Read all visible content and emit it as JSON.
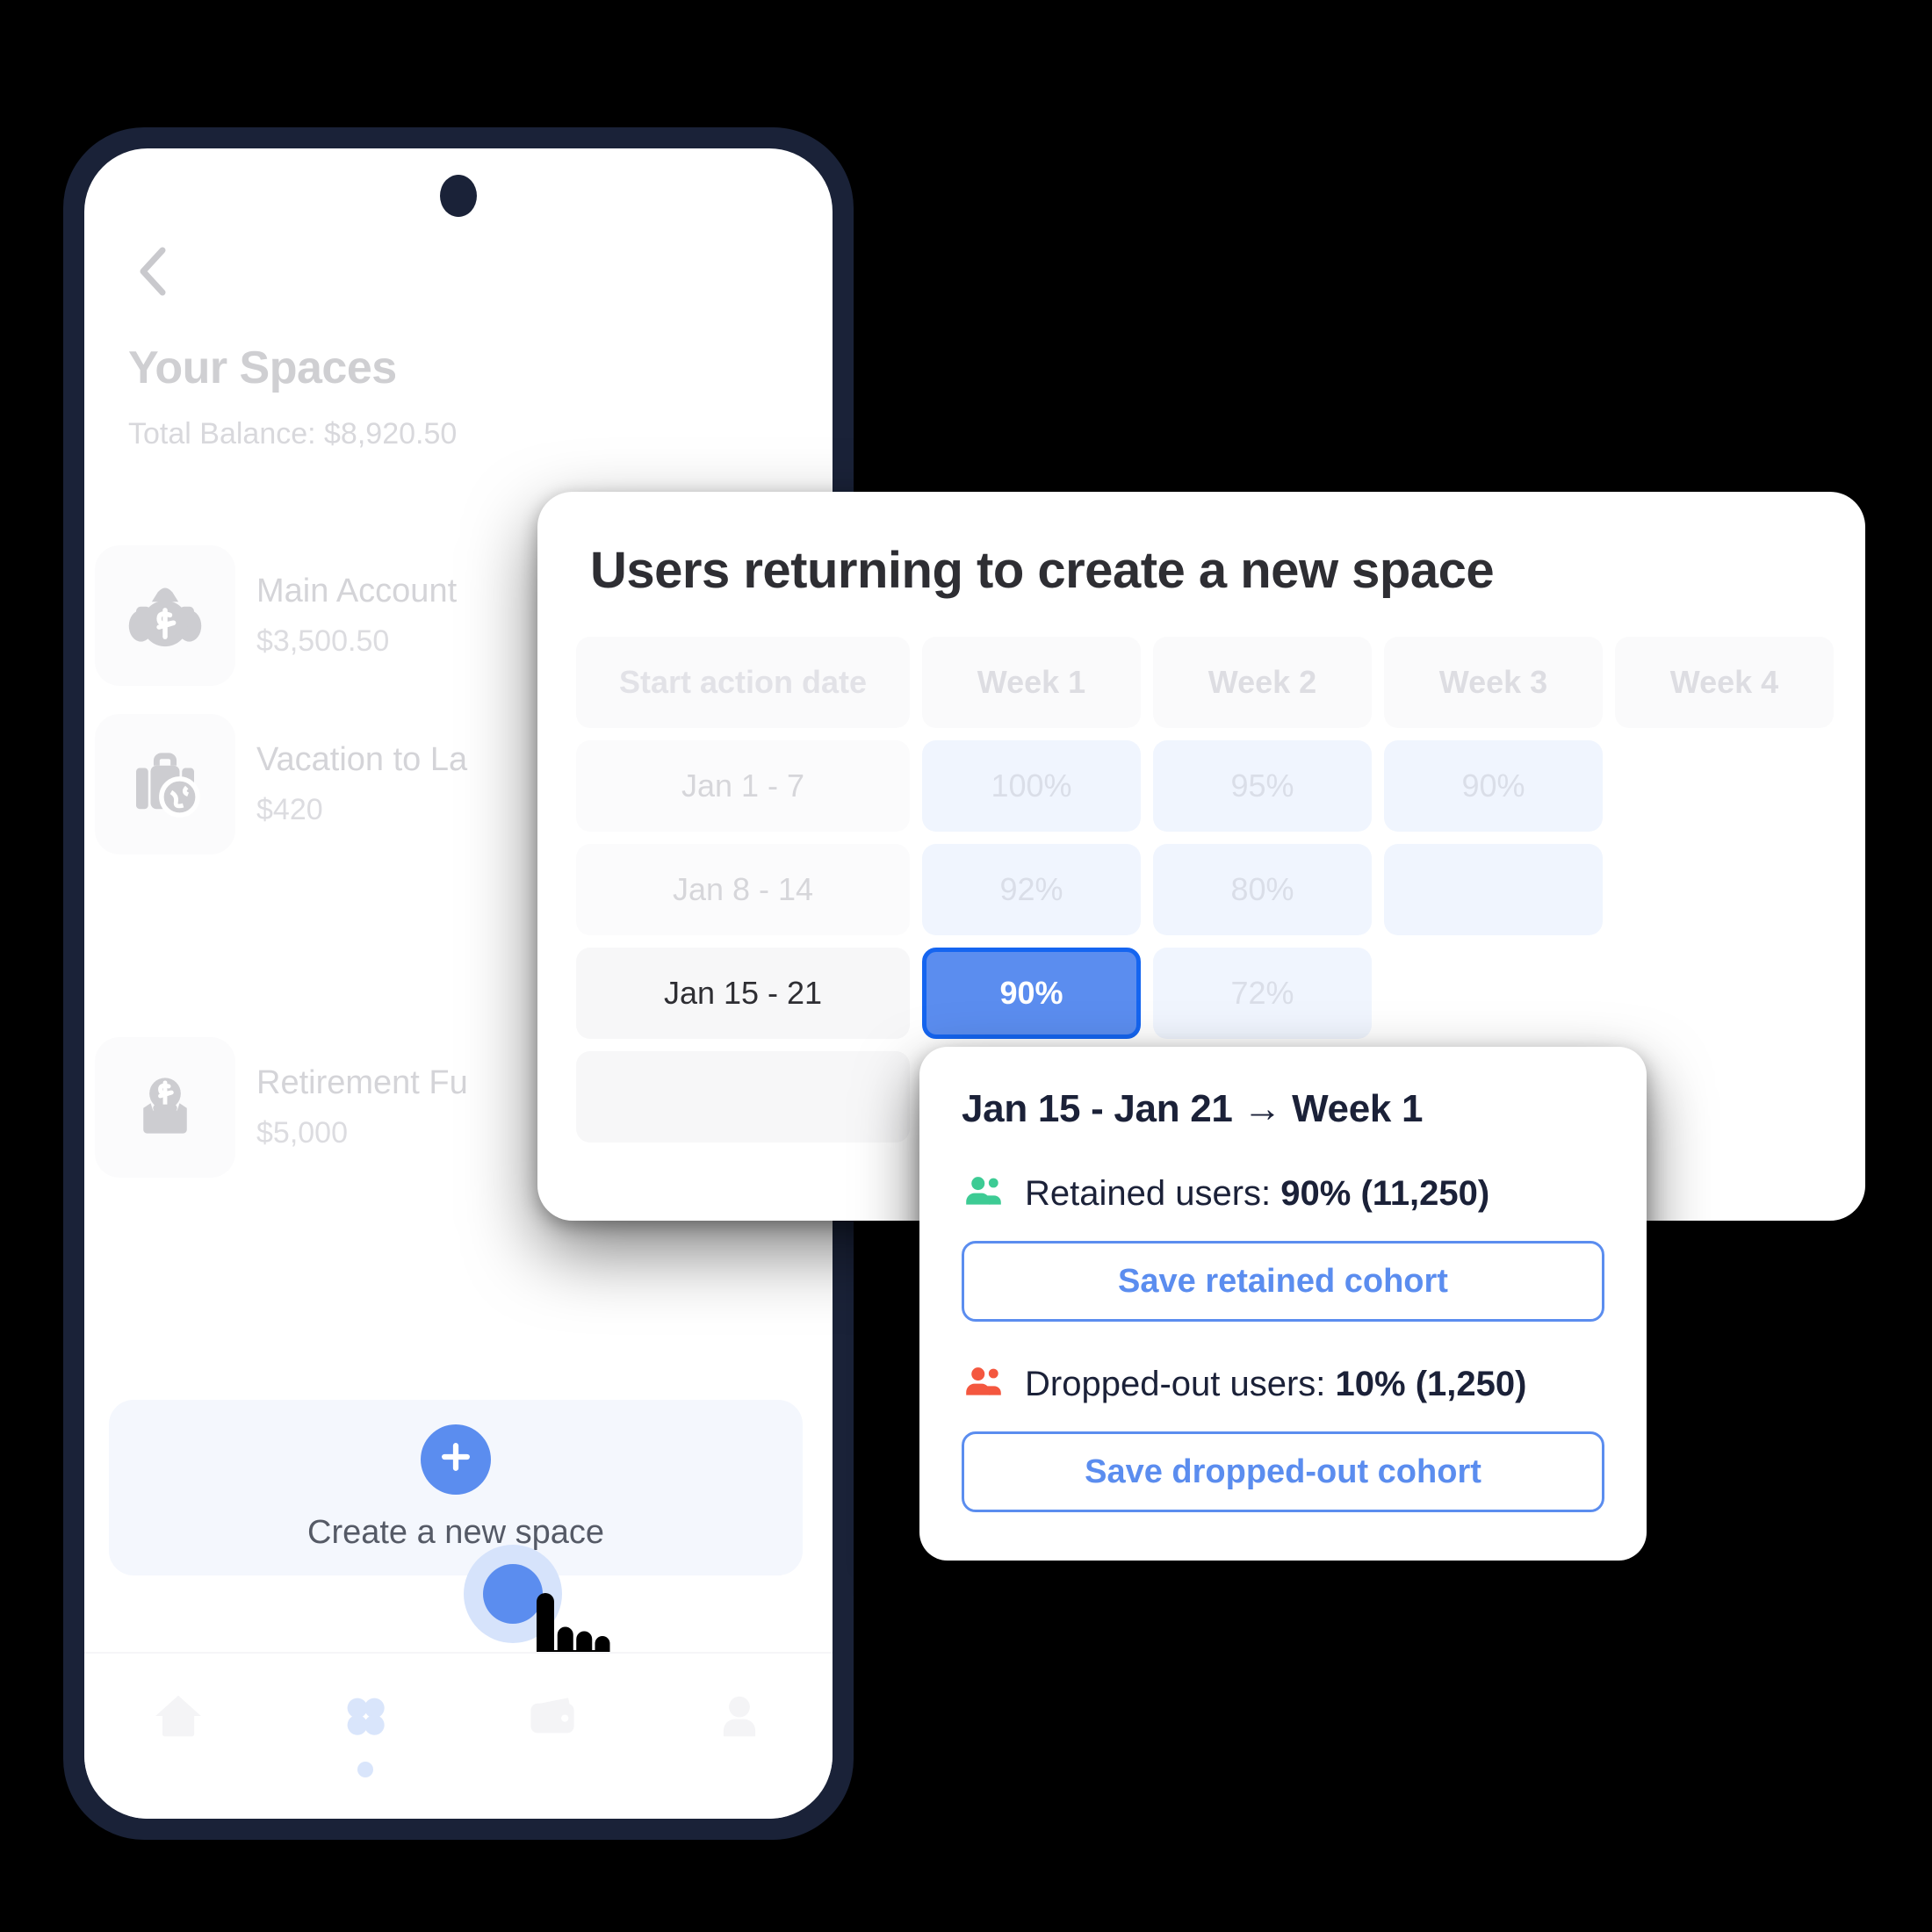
{
  "phone": {
    "back_icon": "chevron-left-icon",
    "title": "Your Spaces",
    "total_balance": "Total Balance: $8,920.50",
    "spaces": [
      {
        "icon": "money-bag-icon",
        "name": "Main Account",
        "amount": "$3,500.50"
      },
      {
        "icon": "travel-suitcase-icon",
        "name": "Vacation to La",
        "amount": "$420"
      },
      {
        "icon": "coin-deposit-icon",
        "name": "Retirement Fu",
        "amount": "$5,000"
      }
    ],
    "create_space": {
      "plus_icon": "plus-icon",
      "label": "Create a new space"
    },
    "bottom_nav": [
      {
        "icon": "home-icon",
        "active": false
      },
      {
        "icon": "grid-dots-icon",
        "active": true
      },
      {
        "icon": "wallet-icon",
        "active": false
      },
      {
        "icon": "person-icon",
        "active": false
      }
    ]
  },
  "cohort": {
    "title": "Users returning to create a new space",
    "columns": [
      "Start action date",
      "Week 1",
      "Week 2",
      "Week 3",
      "Week 4"
    ],
    "rows": [
      {
        "date": "Jan 1 - 7",
        "values": [
          "100%",
          "95%",
          "90%",
          ""
        ],
        "selected_index": -1,
        "highlight": false
      },
      {
        "date": "Jan 8 - 14",
        "values": [
          "92%",
          "80%",
          "",
          ""
        ],
        "selected_index": -1,
        "highlight": false
      },
      {
        "date": "Jan 15 - 21",
        "values": [
          "90%",
          "72%",
          "",
          ""
        ],
        "selected_index": 0,
        "highlight": true
      },
      {
        "date": "",
        "values": [
          "",
          "",
          "",
          ""
        ],
        "selected_index": -1,
        "highlight": false
      }
    ]
  },
  "tooltip": {
    "heading": "Jan 15 - Jan 21 → Week 1",
    "retained": {
      "icon": "people-green-icon",
      "label_prefix": "Retained users: ",
      "value": "90% (11,250)",
      "button_label": "Save retained cohort"
    },
    "dropped": {
      "icon": "people-red-icon",
      "label_prefix": "Dropped-out users: ",
      "value": "10% (1,250)",
      "button_label": "Save dropped-out cohort"
    }
  },
  "colors": {
    "accent_blue": "#5b8def",
    "selected_border": "#1565f0",
    "phone_frame": "#1a2238",
    "green": "#3dcb94",
    "red": "#f4573f",
    "cell_tint": "#f0f5fe"
  },
  "chart_data": {
    "type": "heatmap",
    "title": "Users returning to create a new space",
    "xlabel": "",
    "ylabel": "",
    "categories": [
      "Week 1",
      "Week 2",
      "Week 3",
      "Week 4"
    ],
    "rows": [
      "Jan 1 - 7",
      "Jan 8 - 14",
      "Jan 15 - 21"
    ],
    "series": [
      {
        "name": "Jan 1 - 7",
        "values": [
          100,
          95,
          90,
          null
        ]
      },
      {
        "name": "Jan 8 - 14",
        "values": [
          92,
          80,
          null,
          null
        ]
      },
      {
        "name": "Jan 15 - 21",
        "values": [
          90,
          72,
          null,
          null
        ]
      }
    ],
    "selected_cell": {
      "row": "Jan 15 - 21",
      "column": "Week 1",
      "value": 90
    },
    "annotations": [
      "Retained users: 90% (11,250)",
      "Dropped-out users: 10% (1,250)"
    ],
    "grid": false,
    "legend": "none"
  }
}
